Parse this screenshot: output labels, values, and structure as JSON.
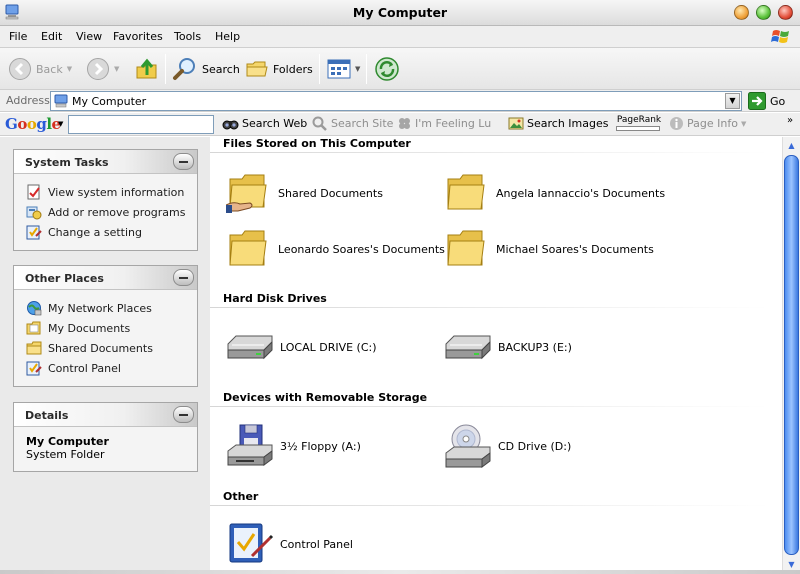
{
  "window": {
    "title": "My Computer"
  },
  "menu": [
    "File",
    "Edit",
    "View",
    "Favorites",
    "Tools",
    "Help"
  ],
  "toolbar": {
    "back": "Back",
    "search": "Search",
    "folders": "Folders"
  },
  "address": {
    "label": "Address",
    "value": "My Computer",
    "go": "Go"
  },
  "google_bar": {
    "logo": "Google",
    "search_web": "Search Web",
    "search_site": "Search Site",
    "feeling_lucky": "I'm Feeling Lu",
    "search_images": "Search Images",
    "pagerank": "PageRank",
    "page_info": "Page Info"
  },
  "sidebar": {
    "system_tasks": {
      "title": "System Tasks",
      "items": [
        "View system information",
        "Add or remove programs",
        "Change a setting"
      ]
    },
    "other_places": {
      "title": "Other Places",
      "items": [
        "My Network Places",
        "My Documents",
        "Shared Documents",
        "Control Panel"
      ]
    },
    "details": {
      "title": "Details",
      "name": "My Computer",
      "type": "System Folder"
    }
  },
  "main": {
    "files_stored": {
      "title": "Files Stored on This Computer",
      "items": [
        "Shared Documents",
        "Angela Iannaccio's Documents",
        "Leonardo Soares's Documents",
        "Michael Soares's Documents"
      ]
    },
    "hard_disks": {
      "title": "Hard Disk Drives",
      "items": [
        "LOCAL DRIVE (C:)",
        "BACKUP3 (E:)"
      ]
    },
    "removable": {
      "title": "Devices with Removable Storage",
      "items": [
        "3½ Floppy (A:)",
        "CD Drive (D:)"
      ]
    },
    "other": {
      "title": "Other",
      "items": [
        "Control Panel"
      ]
    }
  },
  "colors": {
    "accent": "#3a78e0",
    "folder": "#f5d66b",
    "go_green": "#2f9a2f"
  }
}
